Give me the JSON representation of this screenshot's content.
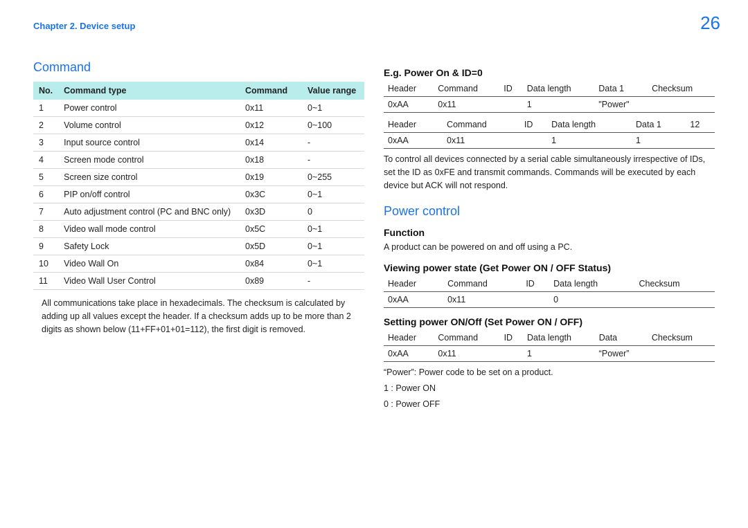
{
  "chapter": "Chapter 2. Device setup",
  "page": "26",
  "left": {
    "title": "Command",
    "headers": {
      "no": "No.",
      "type": "Command type",
      "cmd": "Command",
      "range": "Value range"
    },
    "rows": [
      {
        "no": "1",
        "type": "Power control",
        "cmd": "0x11",
        "range": "0~1"
      },
      {
        "no": "2",
        "type": "Volume control",
        "cmd": "0x12",
        "range": "0~100"
      },
      {
        "no": "3",
        "type": "Input source control",
        "cmd": "0x14",
        "range": "-"
      },
      {
        "no": "4",
        "type": "Screen mode control",
        "cmd": "0x18",
        "range": "-"
      },
      {
        "no": "5",
        "type": "Screen size control",
        "cmd": "0x19",
        "range": "0~255"
      },
      {
        "no": "6",
        "type": "PIP on/off control",
        "cmd": "0x3C",
        "range": "0~1"
      },
      {
        "no": "7",
        "type": "Auto adjustment control (PC and BNC only)",
        "cmd": "0x3D",
        "range": "0"
      },
      {
        "no": "8",
        "type": "Video wall mode control",
        "cmd": "0x5C",
        "range": "0~1"
      },
      {
        "no": "9",
        "type": "Safety Lock",
        "cmd": "0x5D",
        "range": "0~1"
      },
      {
        "no": "10",
        "type": "Video Wall On",
        "cmd": "0x84",
        "range": "0~1"
      },
      {
        "no": "11",
        "type": "Video Wall User Control",
        "cmd": "0x89",
        "range": "-"
      }
    ],
    "note": "All communications take place in hexadecimals. The checksum is calculated by adding up all values except the header. If a checksum adds up to be more than 2 digits as shown below (11+FF+01+01=112), the first digit is removed."
  },
  "right": {
    "eg_title": "E.g. Power On & ID=0",
    "t1": {
      "h": [
        "Header",
        "Command",
        "ID",
        "Data length",
        "Data 1",
        "Checksum"
      ],
      "r": [
        "0xAA",
        "0x11",
        "",
        "1",
        "\"Power\"",
        ""
      ]
    },
    "t2": {
      "h": [
        "Header",
        "Command",
        "ID",
        "Data length",
        "Data 1",
        "12"
      ],
      "r": [
        "0xAA",
        "0x11",
        "",
        "1",
        "1",
        ""
      ]
    },
    "note1": "To control all devices connected by a serial cable simultaneously irrespective of IDs, set the ID as 0xFE and transmit commands. Commands will be executed by each device but ACK will not respond.",
    "pc_title": "Power control",
    "function_label": "Function",
    "function_text": "A product can be powered on and off using a PC.",
    "view_title": "Viewing power state (Get Power ON / OFF Status)",
    "t3": {
      "h": [
        "Header",
        "Command",
        "ID",
        "Data length",
        "Checksum"
      ],
      "r": [
        "0xAA",
        "0x11",
        "",
        "0",
        ""
      ]
    },
    "set_title": "Setting power ON/Off (Set Power ON / OFF)",
    "t4": {
      "h": [
        "Header",
        "Command",
        "ID",
        "Data length",
        "Data",
        "Checksum"
      ],
      "r": [
        "0xAA",
        "0x11",
        "",
        "1",
        "“Power”",
        ""
      ]
    },
    "power_note": "“Power”: Power code to be set on a product.",
    "power_on": "1 : Power ON",
    "power_off": "0 : Power OFF"
  }
}
